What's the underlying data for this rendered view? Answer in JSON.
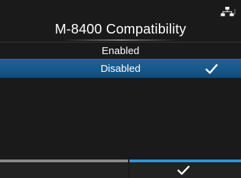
{
  "header": {
    "title": "M-8400 Compatibility",
    "status_icon": "network-icon"
  },
  "options": [
    {
      "label": "Enabled",
      "selected": false
    },
    {
      "label": "Disabled",
      "selected": true
    }
  ],
  "footer": {
    "left_key_icon": "",
    "right_key_icon": "check-icon"
  },
  "colors": {
    "background": "#1a1a1a",
    "selected_row": "#175a8d",
    "left_key_bar": "#8a8a8a",
    "right_key_bar": "#2b9ad4"
  }
}
